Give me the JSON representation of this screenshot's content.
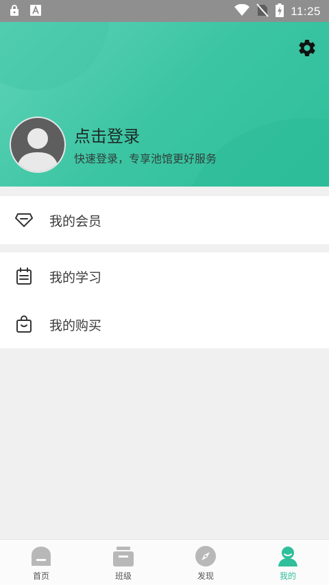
{
  "status_bar": {
    "time": "11:25",
    "icons": [
      "lock-icon",
      "keyboard-icon",
      "wifi-icon",
      "no-sim-icon",
      "battery-charging-icon"
    ]
  },
  "profile": {
    "login_title": "点击登录",
    "login_subtitle": "快速登录，专享池馆更好服务"
  },
  "menu": {
    "membership": {
      "label": "我的会员",
      "icon": "diamond-icon"
    },
    "study": {
      "label": "我的学习",
      "icon": "calendar-icon"
    },
    "purchase": {
      "label": "我的购买",
      "icon": "shopping-bag-icon"
    }
  },
  "tabbar": {
    "items": [
      {
        "label": "首页",
        "icon": "home-icon"
      },
      {
        "label": "班级",
        "icon": "class-icon"
      },
      {
        "label": "发现",
        "icon": "compass-icon"
      },
      {
        "label": "我的",
        "icon": "user-icon"
      }
    ],
    "active_index": 3
  },
  "colors": {
    "accent": "#2fbf9a",
    "header_light": "#5fd3b7",
    "tab_inactive_icon": "#b8b8b8"
  }
}
